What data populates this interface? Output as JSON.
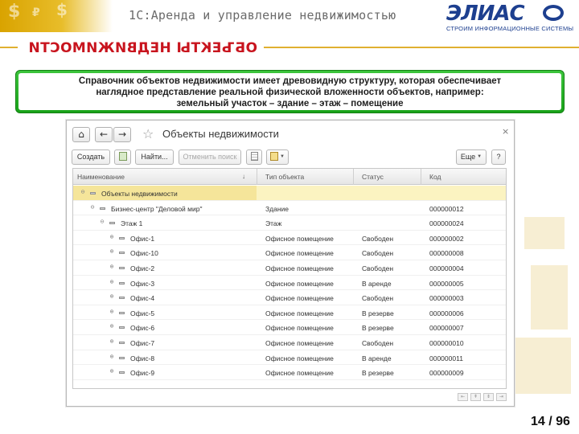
{
  "slide": {
    "title": "1С:Аренда и управление недвижимостью",
    "section_title": "ОБЪЕКТЫ НЕДВИЖИМОСТИ",
    "page_number": "14 / 96",
    "logo": {
      "word": "ЭЛИАС",
      "subtitle": "СТРОИМ ИНФОРМАЦИОННЫЕ СИСТЕМЫ"
    }
  },
  "callout": {
    "lines": [
      "Справочник объектов недвижимости имеет древовидную структуру, которая обеспечивает",
      "наглядное представление реальной физической вложенности объектов, например:",
      "земельный участок – здание – этаж – помещение"
    ]
  },
  "window": {
    "title": "Объекты недвижимости",
    "nav": {
      "home": "⌂",
      "back": "←",
      "forward": "→",
      "favorite": "☆",
      "close": "×"
    },
    "toolbar": {
      "create": "Создать",
      "find": "Найти...",
      "cancel_search": "Отменить поиск",
      "more": "Еще",
      "help": "?"
    },
    "columns": [
      "Наименование",
      "↓",
      "Тип объекта",
      "Статус",
      "Код"
    ],
    "rows": [
      {
        "level": 0,
        "expander": "⊖",
        "name": "Объекты недвижимости",
        "type": "",
        "status": "",
        "code": ""
      },
      {
        "level": 1,
        "expander": "⊖",
        "name": "Бизнес-центр \"Деловой мир\"",
        "type": "Здание",
        "status": "",
        "code": "000000012"
      },
      {
        "level": 2,
        "expander": "⊖",
        "name": "Этаж 1",
        "type": "Этаж",
        "status": "",
        "code": "000000024"
      },
      {
        "level": 3,
        "expander": "⊕",
        "name": "Офис-1",
        "type": "Офисное помещение",
        "status": "Свободен",
        "code": "000000002"
      },
      {
        "level": 3,
        "expander": "⊕",
        "name": "Офис-10",
        "type": "Офисное помещение",
        "status": "Свободен",
        "code": "000000008"
      },
      {
        "level": 3,
        "expander": "⊕",
        "name": "Офис-2",
        "type": "Офисное помещение",
        "status": "Свободен",
        "code": "000000004"
      },
      {
        "level": 3,
        "expander": "⊕",
        "name": "Офис-3",
        "type": "Офисное помещение",
        "status": "В аренде",
        "code": "000000005"
      },
      {
        "level": 3,
        "expander": "⊕",
        "name": "Офис-4",
        "type": "Офисное помещение",
        "status": "Свободен",
        "code": "000000003"
      },
      {
        "level": 3,
        "expander": "⊕",
        "name": "Офис-5",
        "type": "Офисное помещение",
        "status": "В резерве",
        "code": "000000006"
      },
      {
        "level": 3,
        "expander": "⊕",
        "name": "Офис-6",
        "type": "Офисное помещение",
        "status": "В резерве",
        "code": "000000007"
      },
      {
        "level": 3,
        "expander": "⊕",
        "name": "Офис-7",
        "type": "Офисное помещение",
        "status": "Свободен",
        "code": "000000010"
      },
      {
        "level": 3,
        "expander": "⊕",
        "name": "Офис-8",
        "type": "Офисное помещение",
        "status": "В аренде",
        "code": "000000011"
      },
      {
        "level": 3,
        "expander": "⊕",
        "name": "Офис-9",
        "type": "Офисное помещение",
        "status": "В резерве",
        "code": "000000009"
      }
    ],
    "footer_controls": [
      "⇤",
      "⇞",
      "⇟",
      "⇥"
    ]
  },
  "colors": {
    "accent_red": "#c8141e",
    "callout_green": "#19a319",
    "logo_blue": "#1d3f8f",
    "gold": "#e0b030",
    "selected_row": "#fbf3c1"
  },
  "icons": [
    "home-icon",
    "back-arrow-icon",
    "forward-arrow-icon",
    "star-icon",
    "close-icon",
    "create-copy-icon",
    "list-icon",
    "report-icon"
  ]
}
